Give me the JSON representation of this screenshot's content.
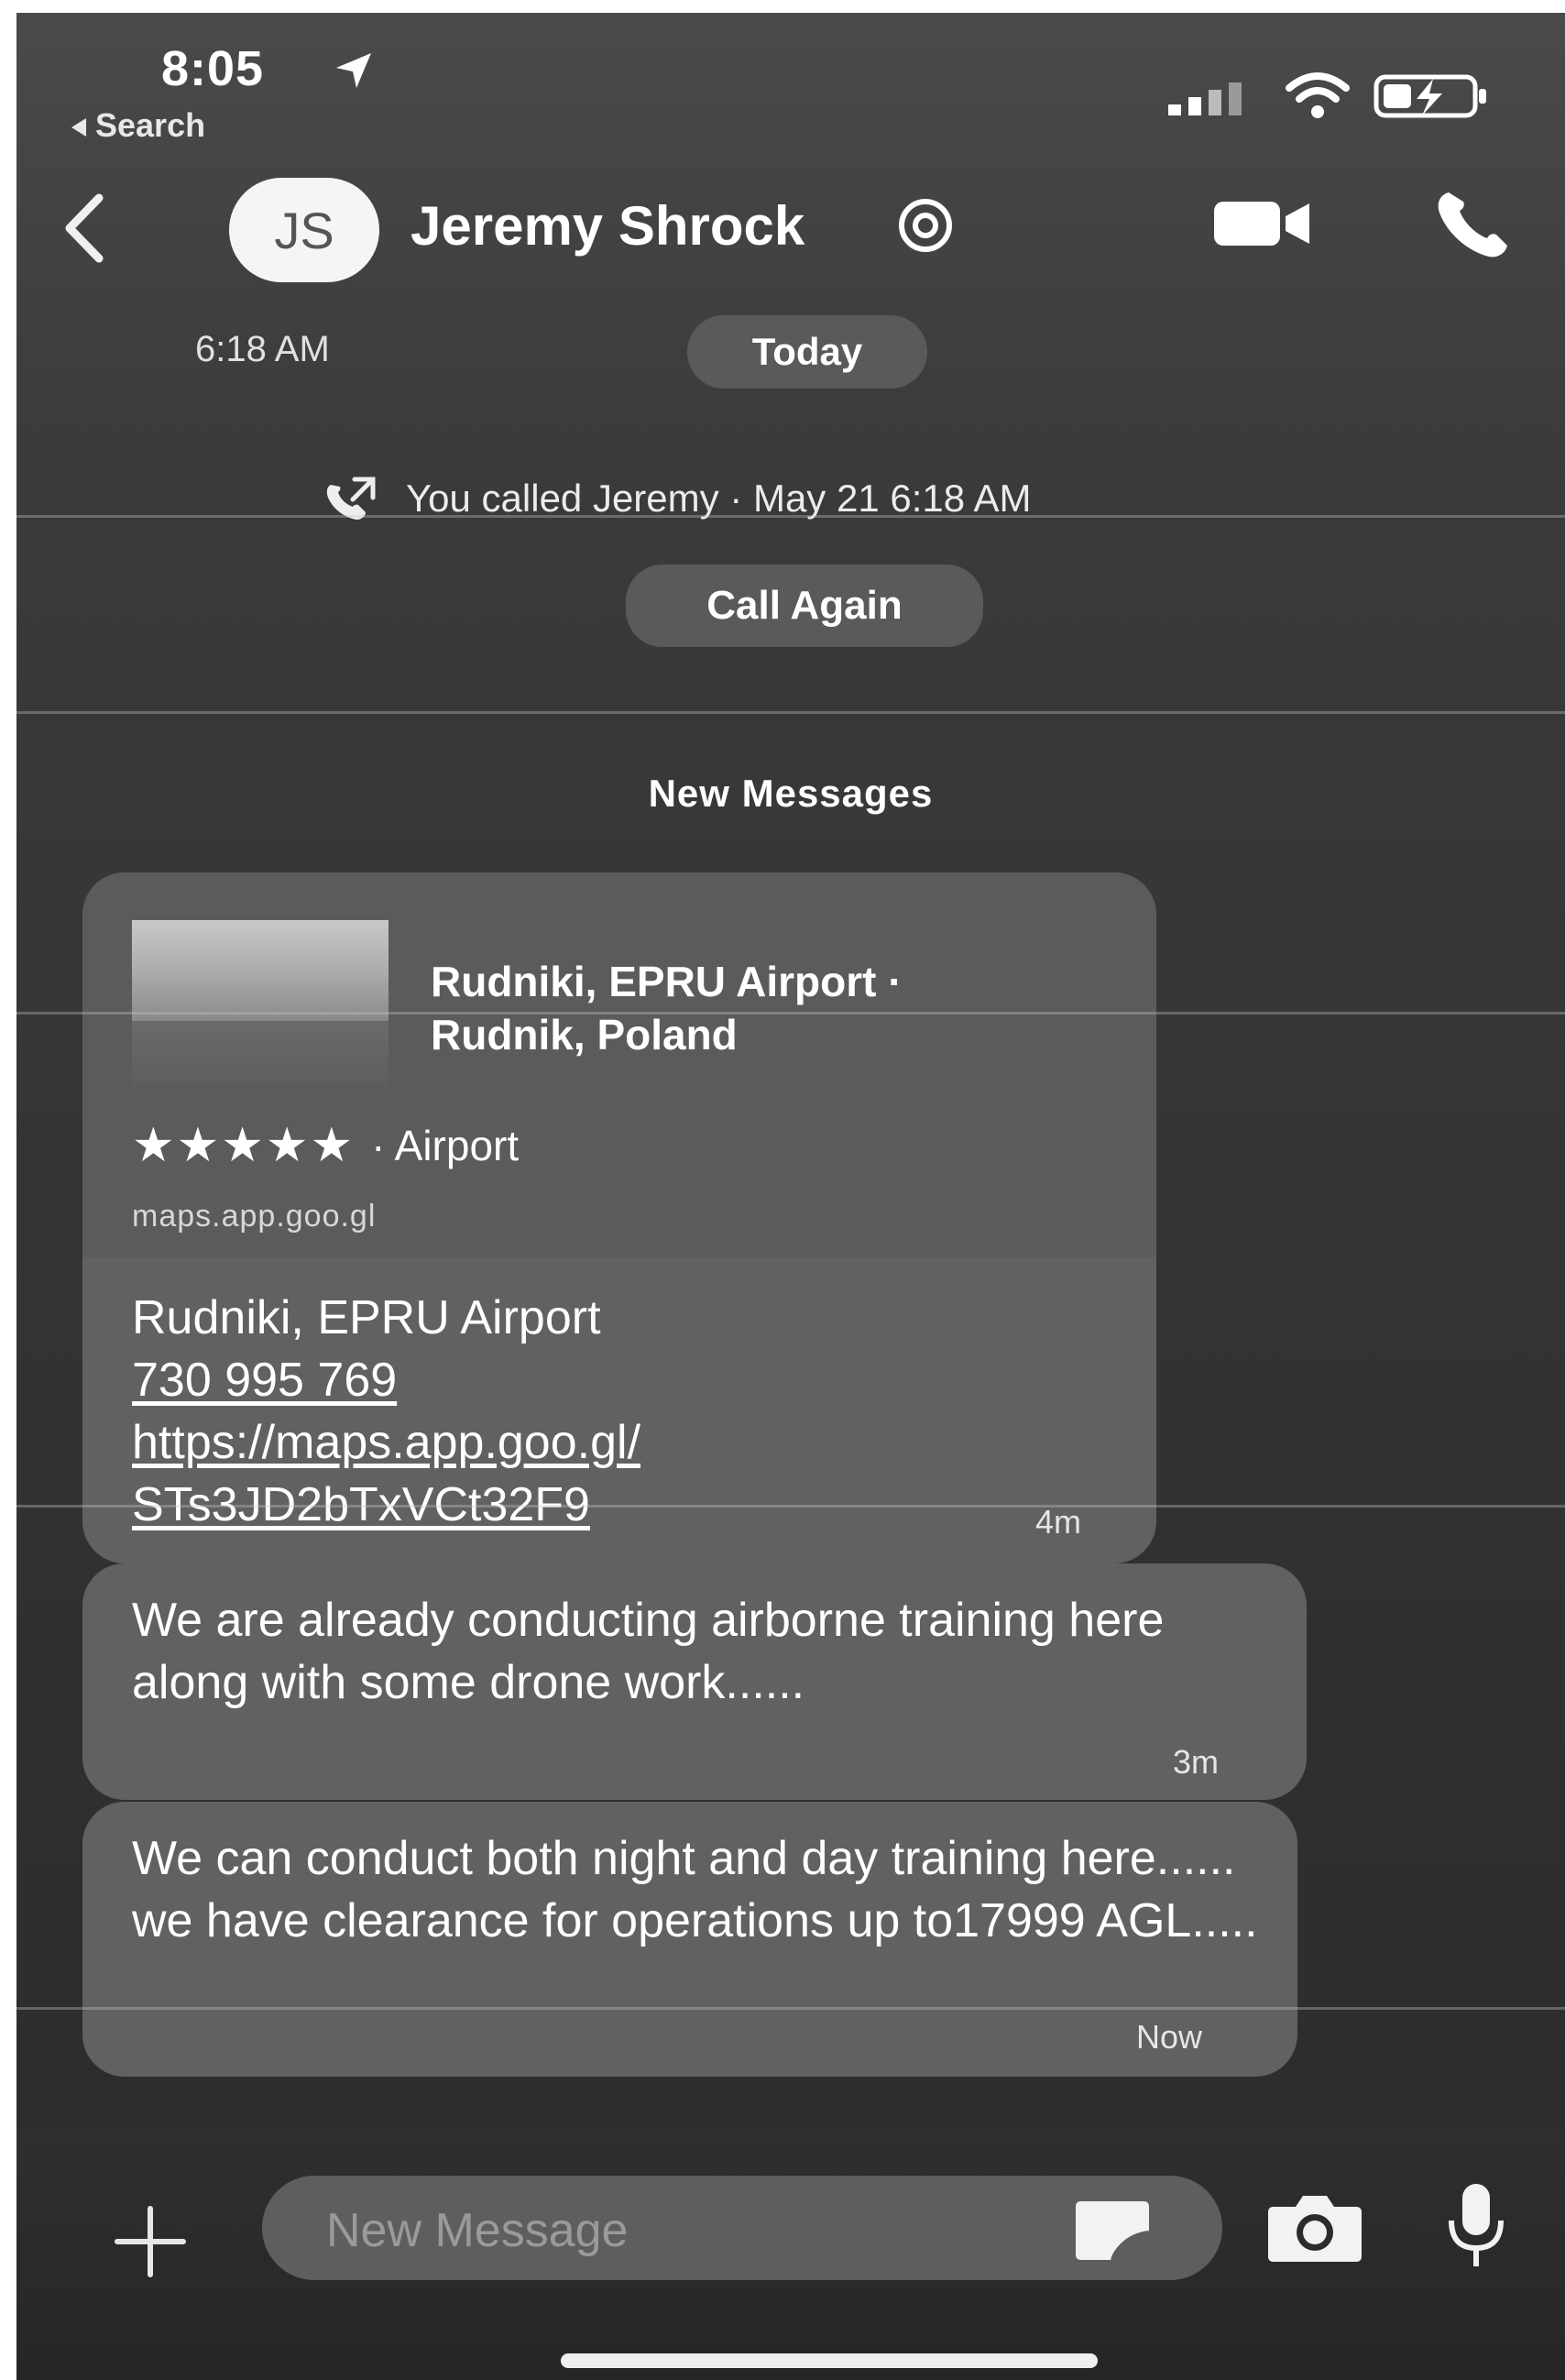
{
  "status_bar": {
    "time": "8:05",
    "back_label": "Search"
  },
  "header": {
    "avatar_initials": "JS",
    "contact_name": "Jeremy Shrock"
  },
  "timeline": {
    "left_time": "6:18 AM",
    "day_label": "Today",
    "call_log": "You called Jeremy · May 21 6:18 AM",
    "call_again_label": "Call Again",
    "new_messages_label": "New Messages"
  },
  "messages": [
    {
      "type": "link",
      "place_title_line1": "Rudniki, EPRU Airport ·",
      "place_title_line2": "Rudnik, Poland",
      "rating_stars": "★★★★★",
      "rating_value": 5,
      "category": "· Airport",
      "domain": "maps.app.goo.gl",
      "body_line1": "Rudniki, EPRU Airport",
      "phone": "730 995 769",
      "url_line1": "https://maps.app.goo.gl/",
      "url_line2": "STs3JD2bTxVCt32F9",
      "timestamp": "4m"
    },
    {
      "type": "text",
      "text": "We are already conducting airborne training here along with some drone work......",
      "timestamp": "3m"
    },
    {
      "type": "text",
      "text": "We can conduct both night and day training here...... we have clearance for operations up to17999 AGL.....",
      "timestamp": "Now"
    }
  ],
  "composer": {
    "placeholder": "New Message"
  },
  "icons": {
    "back": "chevron-left-icon",
    "location": "location-arrow-icon",
    "video": "video-camera-icon",
    "phone": "phone-icon",
    "call_log": "outgoing-call-icon",
    "add": "plus-icon",
    "sticker": "sticker-icon",
    "camera": "camera-icon",
    "mic": "microphone-icon"
  }
}
